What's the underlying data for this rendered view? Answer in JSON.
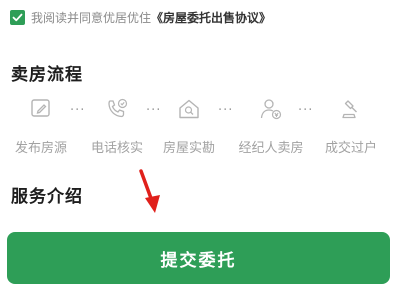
{
  "agreement": {
    "checked": true,
    "prefix": "我阅读并同意优居优住",
    "link": "《房屋委托出售协议》"
  },
  "flow": {
    "title": "卖房流程",
    "steps": [
      {
        "label": "发布房源",
        "icon": "edit-document-icon"
      },
      {
        "label": "电话核实",
        "icon": "phone-check-icon"
      },
      {
        "label": "房屋实勘",
        "icon": "house-inspect-icon"
      },
      {
        "label": "经纪人卖房",
        "icon": "agent-icon"
      },
      {
        "label": "成交过户",
        "icon": "gavel-icon"
      }
    ],
    "separator": "···"
  },
  "service": {
    "title": "服务介绍"
  },
  "submit": {
    "label": "提交委托"
  },
  "colors": {
    "accent": "#2e9e57",
    "arrow": "#e0201b",
    "muted": "#a2a2a2"
  }
}
